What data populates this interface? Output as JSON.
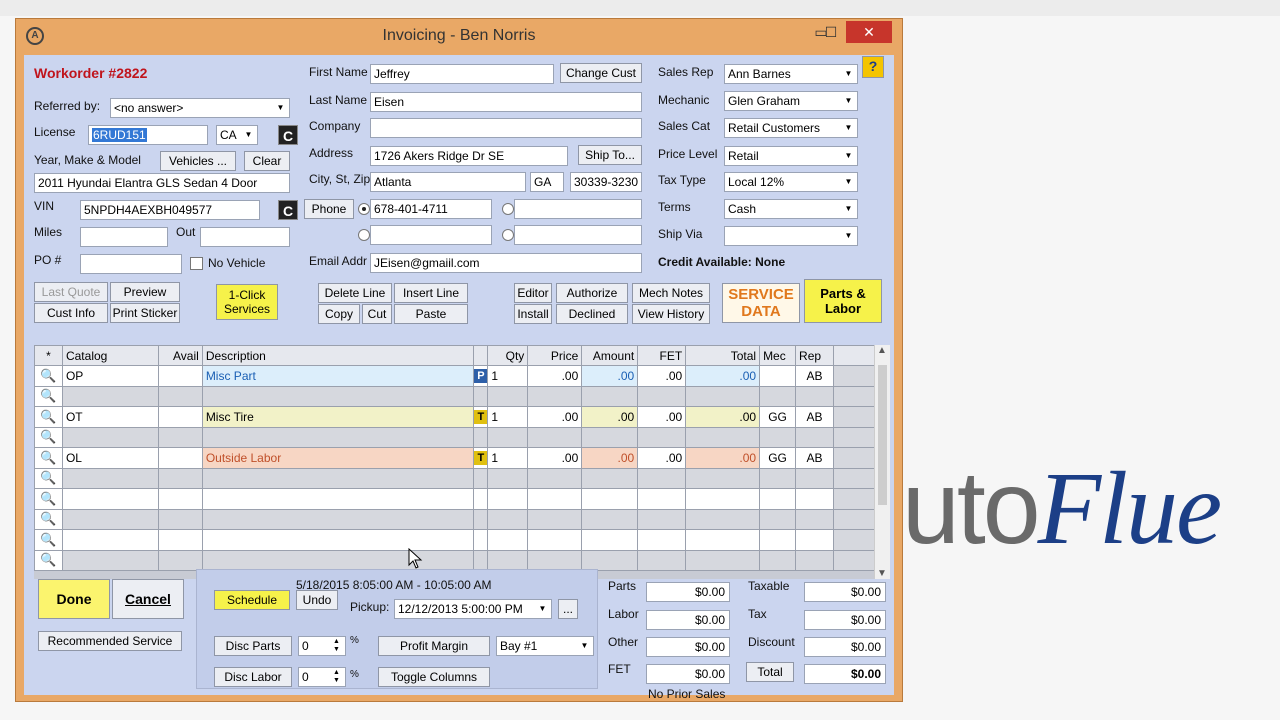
{
  "window": {
    "title": "Invoicing - Ben Norris",
    "minimize": "▭",
    "maximize": "☐",
    "close": "✕"
  },
  "brand": {
    "gray": "uto",
    "blue": "Flue"
  },
  "wo": {
    "title": "Workorder #2822",
    "help": "?"
  },
  "left": {
    "referred_label": "Referred by:",
    "referred_value": "<no answer>",
    "license_label": "License",
    "license_value": "6RUD151",
    "state": "CA",
    "ymm_label": "Year, Make & Model",
    "vehicles_btn": "Vehicles ...",
    "clear_btn": "Clear",
    "vehicle": "2011 Hyundai Elantra GLS Sedan 4 Door",
    "vin_label": "VIN",
    "vin": "5NPDH4AEXBH049577",
    "miles_label": "Miles",
    "out_label": "Out",
    "po_label": "PO #",
    "novehicle": "No Vehicle",
    "cicon": "C"
  },
  "cust": {
    "first_label": "First Name",
    "first": "Jeffrey",
    "change_btn": "Change Cust",
    "last_label": "Last Name",
    "last": "Eisen",
    "company_label": "Company",
    "address_label": "Address",
    "address": "1726 Akers Ridge Dr SE",
    "shipto_btn": "Ship To...",
    "city_label": "City, St, Zip",
    "city": "Atlanta",
    "st": "GA",
    "zip": "30339-3230",
    "phone_btn": "Phone",
    "phone": "678-401-4711",
    "email_label": "Email Addr",
    "email": "JEisen@gmaiil.com"
  },
  "right": {
    "salesrep_label": "Sales Rep",
    "salesrep": "Ann Barnes",
    "mechanic_label": "Mechanic",
    "mechanic": "Glen Graham",
    "salescat_label": "Sales Cat",
    "salescat": "Retail Customers",
    "price_label": "Price Level",
    "price": "Retail",
    "tax_label": "Tax Type",
    "tax": "Local 12%",
    "terms_label": "Terms",
    "terms": "Cash",
    "shipvia_label": "Ship Via",
    "credit": "Credit Available: None"
  },
  "toolbar": {
    "last_quote": "Last Quote",
    "preview": "Preview",
    "cust_info": "Cust Info",
    "print_sticker": "Print Sticker",
    "oneclick": "1-Click Services",
    "delete_line": "Delete Line",
    "insert_line": "Insert Line",
    "copy": "Copy",
    "cut": "Cut",
    "paste": "Paste",
    "editor": "Editor",
    "authorize": "Authorize",
    "mech_notes": "Mech Notes",
    "install": "Install",
    "declined": "Declined",
    "view_history": "View History",
    "service_data": "SERVICE DATA",
    "parts_labor": "Parts & Labor"
  },
  "grid": {
    "headers": [
      "*",
      "Catalog",
      "Avail",
      "Description",
      "",
      "Qty",
      "Price",
      "Amount",
      "FET",
      "Total",
      "Mec",
      "Rep"
    ],
    "rows": [
      {
        "catalog": "OP",
        "desc": "Misc Part",
        "type": "P",
        "qty": "1",
        "price": ".00",
        "amount": ".00",
        "fet": ".00",
        "total": ".00",
        "mec": "",
        "rep": "AB"
      },
      {
        "catalog": "OT",
        "desc": "Misc Tire",
        "type": "T",
        "qty": "1",
        "price": ".00",
        "amount": ".00",
        "fet": ".00",
        "total": ".00",
        "mec": "GG",
        "rep": "AB"
      },
      {
        "catalog": "OL",
        "desc": "Outside Labor",
        "type": "T",
        "qty": "1",
        "price": ".00",
        "amount": ".00",
        "fet": ".00",
        "total": ".00",
        "mec": "GG",
        "rep": "AB"
      }
    ],
    "magnifier": "🔍"
  },
  "bottom": {
    "done": "Done",
    "cancel": "Cancel",
    "recommended": "Recommended Service",
    "schedule": "Schedule",
    "undo": "Undo",
    "appointment": "5/18/2015 8:05:00 AM - 10:05:00 AM",
    "pickup_label": "Pickup:",
    "pickup": "12/12/2013 5:00:00 PM",
    "ellipsis": "...",
    "disc_parts": "Disc Parts",
    "disc_labor": "Disc Labor",
    "disc_parts_val": "0",
    "disc_labor_val": "0",
    "pct": "%",
    "profit_margin": "Profit Margin",
    "toggle_columns": "Toggle Columns",
    "bay": "Bay #1",
    "no_prior": "No Prior Sales"
  },
  "totals": {
    "parts_label": "Parts",
    "parts": "$0.00",
    "labor_label": "Labor",
    "labor": "$0.00",
    "other_label": "Other",
    "other": "$0.00",
    "fet_label": "FET",
    "fet": "$0.00",
    "taxable_label": "Taxable",
    "taxable": "$0.00",
    "tax_label": "Tax",
    "tax": "$0.00",
    "discount_label": "Discount",
    "discount": "$0.00",
    "total_btn": "Total",
    "total": "$0.00"
  }
}
